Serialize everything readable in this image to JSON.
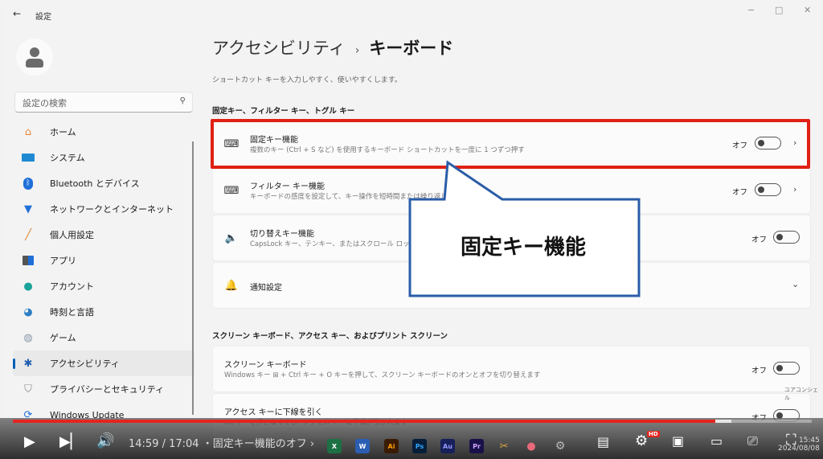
{
  "window": {
    "app_title": "設定",
    "controls": {
      "minimize": "−",
      "maximize": "□",
      "close": "✕"
    }
  },
  "sidebar": {
    "search": {
      "placeholder": "設定の検索"
    },
    "items": [
      {
        "label": "ホーム",
        "icon": "home-icon",
        "active": false
      },
      {
        "label": "システム",
        "icon": "system-icon",
        "active": false
      },
      {
        "label": "Bluetooth とデバイス",
        "icon": "bluetooth-icon",
        "active": false
      },
      {
        "label": "ネットワークとインターネット",
        "icon": "wifi-icon",
        "active": false
      },
      {
        "label": "個人用設定",
        "icon": "brush-icon",
        "active": false
      },
      {
        "label": "アプリ",
        "icon": "apps-icon",
        "active": false
      },
      {
        "label": "アカウント",
        "icon": "account-icon",
        "active": false
      },
      {
        "label": "時刻と言語",
        "icon": "time-language-icon",
        "active": false
      },
      {
        "label": "ゲーム",
        "icon": "gamepad-icon",
        "active": false
      },
      {
        "label": "アクセシビリティ",
        "icon": "accessibility-icon",
        "active": true
      },
      {
        "label": "プライバシーとセキュリティ",
        "icon": "shield-icon",
        "active": false
      },
      {
        "label": "Windows Update",
        "icon": "windows-update-icon",
        "active": false
      }
    ]
  },
  "main": {
    "breadcrumb_parent": "アクセシビリティ",
    "breadcrumb_sep": "›",
    "breadcrumb_current": "キーボード",
    "subtitle": "ショートカット キーを入力しやすく、使いやすくします。",
    "section1_title": "固定キー、フィルター キー、トグル キー",
    "section2_title": "スクリーン キーボード、アクセス キー、およびプリント スクリーン",
    "cards": [
      {
        "title": "固定キー機能",
        "desc": "複数のキー (Ctrl + S など) を使用するキーボード ショートカットを一度に 1 つずつ押す",
        "state": "オフ",
        "toggle_on": false,
        "icon": "sticky-keys-icon"
      },
      {
        "title": "フィルター キー機能",
        "desc": "キーボードの感度を設定して、キー操作を短時間または繰り返し無視する",
        "state": "オフ",
        "toggle_on": false,
        "icon": "filter-keys-icon"
      },
      {
        "title": "切り替えキー機能",
        "desc": "CapsLock キー、テンキー、またはスクロール ロックを押したときにトーンを鳴らす",
        "state": "オフ",
        "toggle_on": false,
        "icon": "toggle-keys-sound-icon"
      },
      {
        "title": "通知設定",
        "icon": "bell-icon"
      },
      {
        "title": "スクリーン キーボード",
        "desc": "Windows キー ⊞ + Ctrl キー + O キーを押して、スクリーン キーボードのオンとオフを切り替えます",
        "state": "オフ",
        "toggle_on": false
      },
      {
        "title": "アクセス キーに下線を引く",
        "desc": "Alt キーを押さなくても、アクセス キーに下線が引かれます",
        "state": "オフ",
        "toggle_on": false
      }
    ]
  },
  "annotation": {
    "callout_text": "固定キー機能",
    "highlight_color": "#e02013",
    "callout_border": "#2a5ca8"
  },
  "player": {
    "current_time": "14:59",
    "duration": "17:04",
    "time_display": "14:59 / 17:04",
    "chapter": "・固定キー機能のオフ ›",
    "progress_fraction": 0.879,
    "hd_badge": "HD",
    "watermark": "ユアコンシェル"
  },
  "taskbar": {
    "apps": [
      {
        "label": "X",
        "icon": "excel-icon",
        "color": "#1d7044"
      },
      {
        "label": "W",
        "icon": "word-icon",
        "color": "#2b5eb3"
      },
      {
        "label": "Ai",
        "icon": "illustrator-icon",
        "color": "#3a1c05"
      },
      {
        "label": "Ps",
        "icon": "photoshop-icon",
        "color": "#061e3a"
      },
      {
        "label": "Au",
        "icon": "audition-icon",
        "color": "#16205a"
      },
      {
        "label": "Pr",
        "icon": "premiere-icon",
        "color": "#19114a"
      }
    ],
    "clock_time": "15:45",
    "clock_date": "2024/08/08"
  }
}
